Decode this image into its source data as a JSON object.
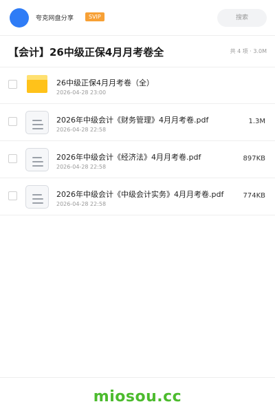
{
  "header": {
    "app_name": "夸克网盘分享",
    "badge": "SVIP",
    "search_placeholder": "搜索",
    "avatar_color": "#2f7cf6",
    "badge_color": "#f7a035"
  },
  "share": {
    "title": "【会计】26中级正保4月月考卷全",
    "summary": "共 4 项 · 3.0M"
  },
  "files": [
    {
      "type": "folder",
      "icon": "folder-icon",
      "name": "26中级正保4月月考卷（全）",
      "date": "2026-04-28 23:00",
      "size": ""
    },
    {
      "type": "pdf",
      "icon": "document-icon",
      "name": "2026年中级会计《财务管理》4月月考卷.pdf",
      "date": "2026-04-28 22:58",
      "size": "1.3M"
    },
    {
      "type": "pdf",
      "icon": "document-icon",
      "name": "2026年中级会计《经济法》4月月考卷.pdf",
      "date": "2026-04-28 22:58",
      "size": "897KB"
    },
    {
      "type": "pdf",
      "icon": "document-icon",
      "name": "2026年中级会计《中级会计实务》4月月考卷.pdf",
      "date": "2026-04-28 22:58",
      "size": "774KB"
    }
  ],
  "footer": {
    "watermark": "miosou.cc",
    "watermark_color": "#4cbb2e"
  }
}
